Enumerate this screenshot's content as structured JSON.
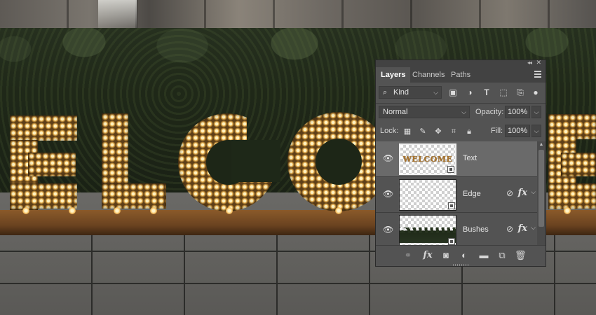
{
  "panel": {
    "tabs": [
      {
        "label": "Layers",
        "active": true
      },
      {
        "label": "Channels",
        "active": false
      },
      {
        "label": "Paths",
        "active": false
      }
    ],
    "filter": {
      "kind_label": "Kind"
    },
    "blend_mode": "Normal",
    "opacity": {
      "label": "Opacity:",
      "value": "100%"
    },
    "lock_label": "Lock:",
    "fill": {
      "label": "Fill:",
      "value": "100%"
    },
    "layers": [
      {
        "name": "Text",
        "thumb_text": "WELCOME",
        "selected": true,
        "has_fx": false
      },
      {
        "name": "Edge",
        "selected": false,
        "has_fx": true
      },
      {
        "name": "Bushes",
        "selected": false,
        "has_fx": true
      }
    ],
    "icons": {
      "filter_buttons": [
        "image-filter-icon",
        "adjustment-filter-icon",
        "type-filter-icon",
        "shape-filter-icon",
        "smart-object-filter-icon",
        "filter-toggle-icon"
      ],
      "lock_buttons": [
        "lock-transparent-pixels-icon",
        "lock-image-pixels-icon",
        "lock-position-icon",
        "lock-artboard-icon",
        "lock-all-icon"
      ],
      "footer_buttons": [
        "link-layers-icon",
        "add-layer-style-icon",
        "add-mask-icon",
        "adjustment-layer-icon",
        "new-group-icon",
        "new-layer-icon",
        "delete-layer-icon"
      ]
    }
  },
  "scene": {
    "sign_letters": [
      "E",
      "L",
      "C",
      "O",
      "E"
    ]
  }
}
